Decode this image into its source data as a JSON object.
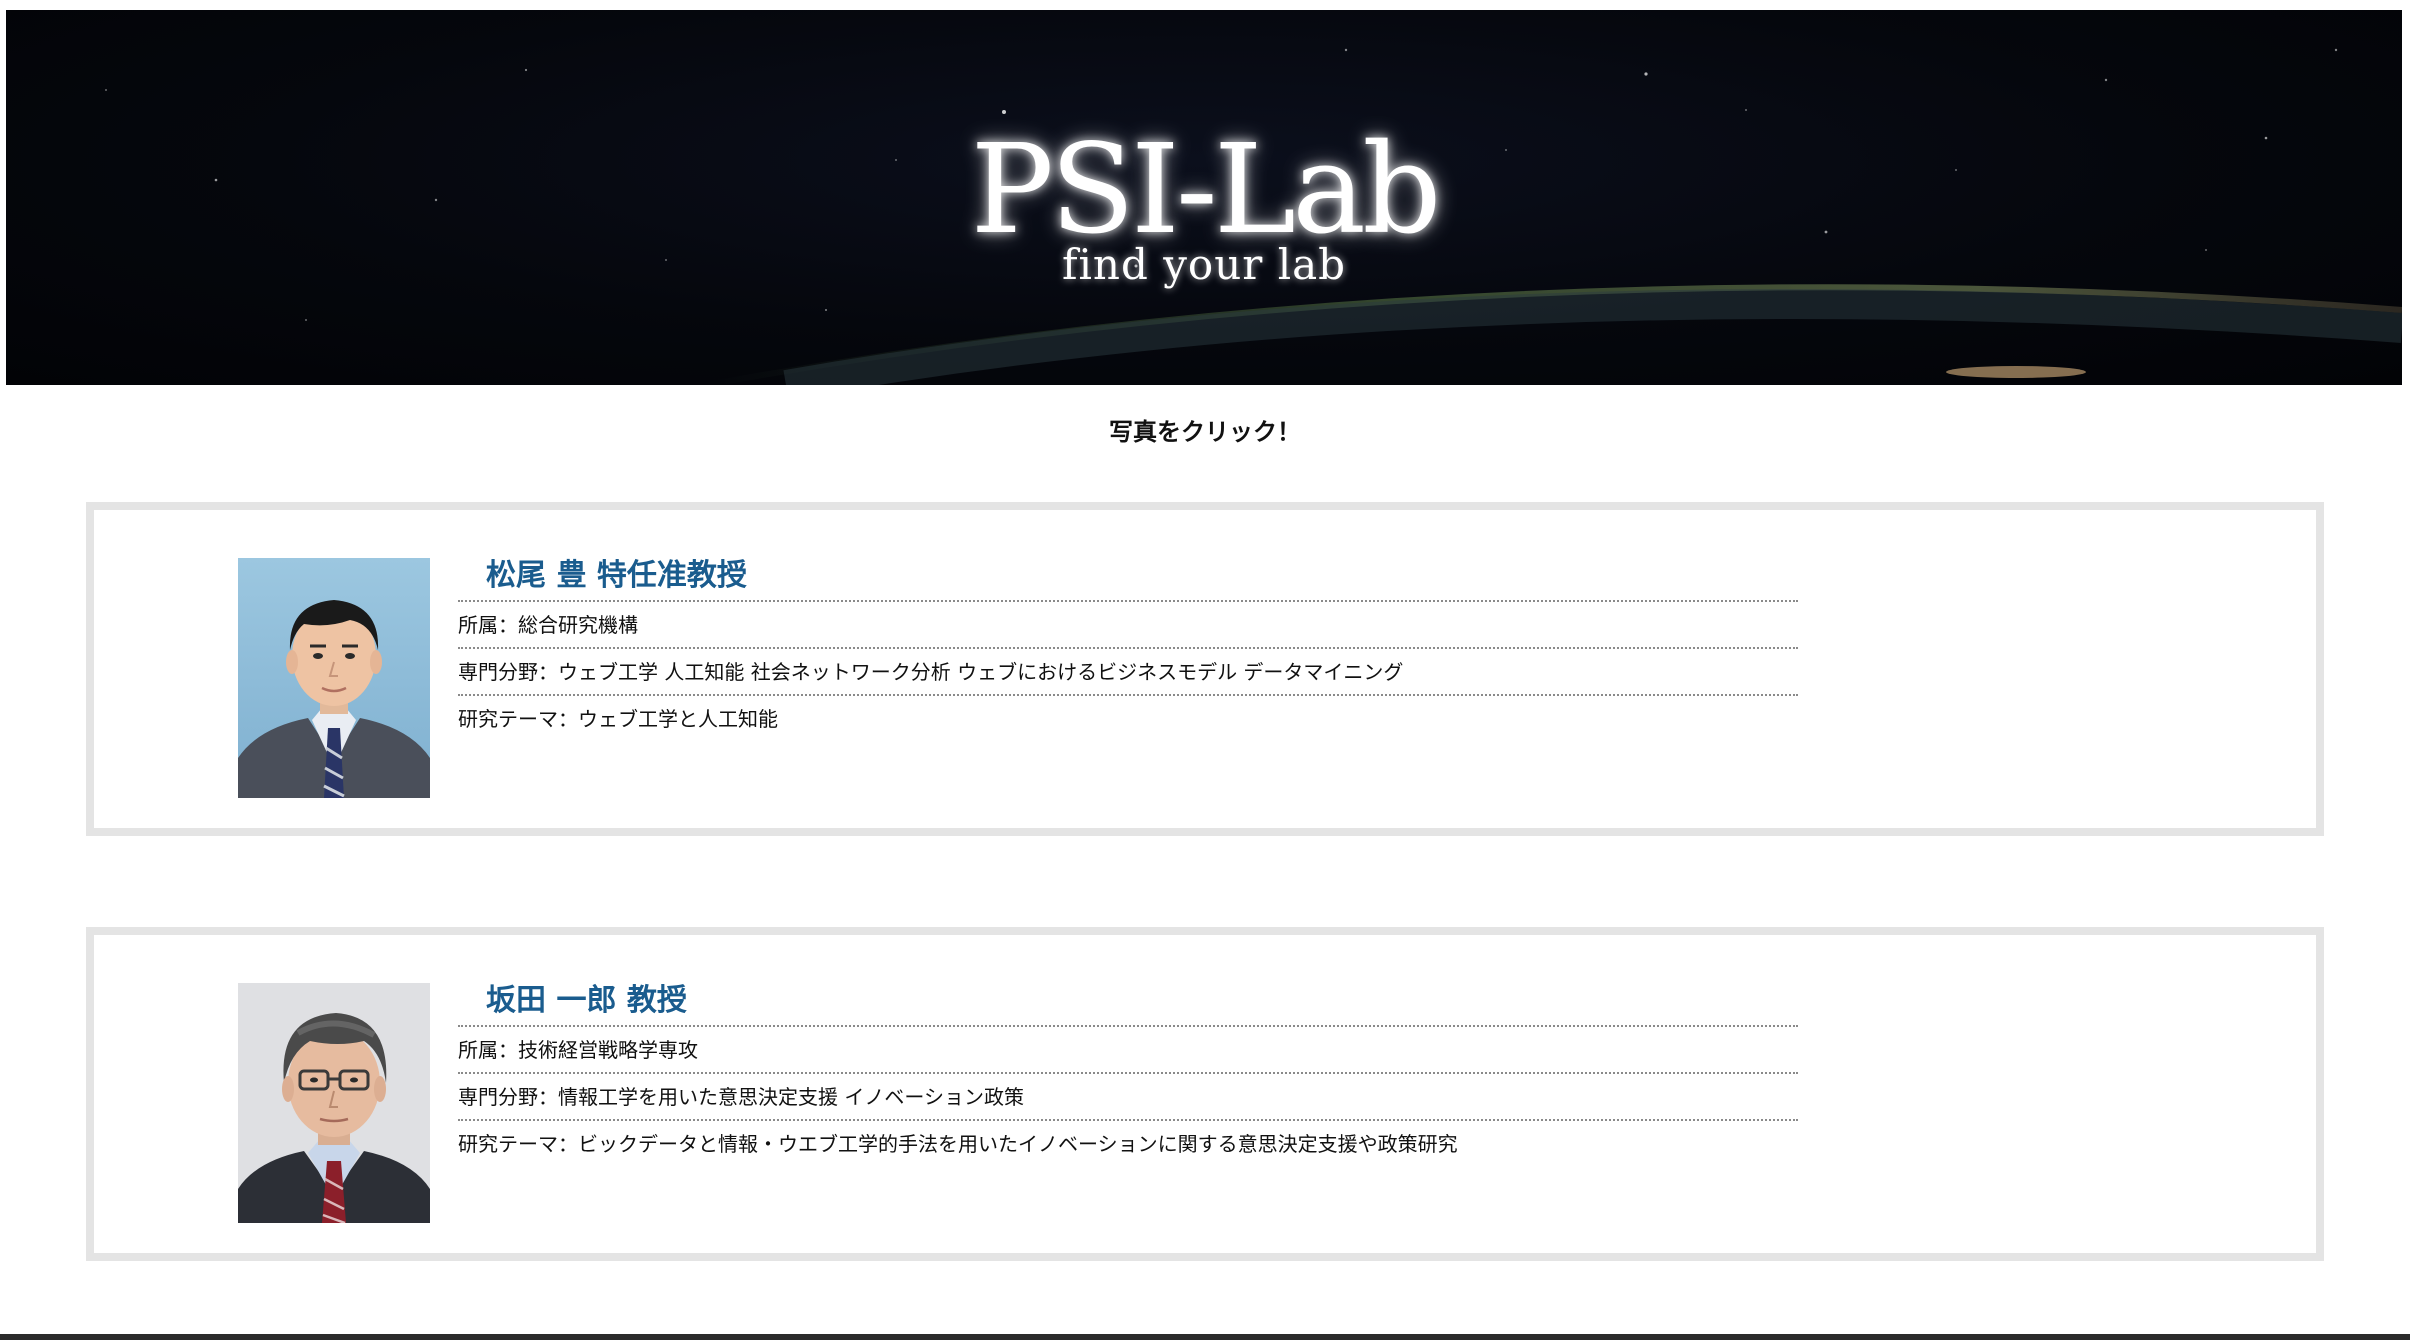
{
  "header": {
    "logo": "PSI-Lab",
    "tagline": "find your lab"
  },
  "hint": "写真をクリック！",
  "members": [
    {
      "name": "松尾 豊 特任准教授",
      "affiliation": "所属：総合研究機構",
      "field": "専門分野：ウェブ工学 人工知能 社会ネットワーク分析 ウェブにおけるビジネスモデル データマイニング",
      "theme": "研究テーマ：ウェブ工学と人工知能"
    },
    {
      "name": "坂田 一郎 教授",
      "affiliation": "所属：技術経営戦略学専攻",
      "field": "専門分野：情報工学を用いた意思決定支援 イノベーション政策",
      "theme": "研究テーマ：ビックデータと情報・ウエブ工学的手法を用いたイノベーションに関する意思決定支援や政策研究"
    }
  ],
  "colors": {
    "name": "#1a5c8e",
    "card_border": "#e4e4e4",
    "banner_bg": "#05070d"
  }
}
